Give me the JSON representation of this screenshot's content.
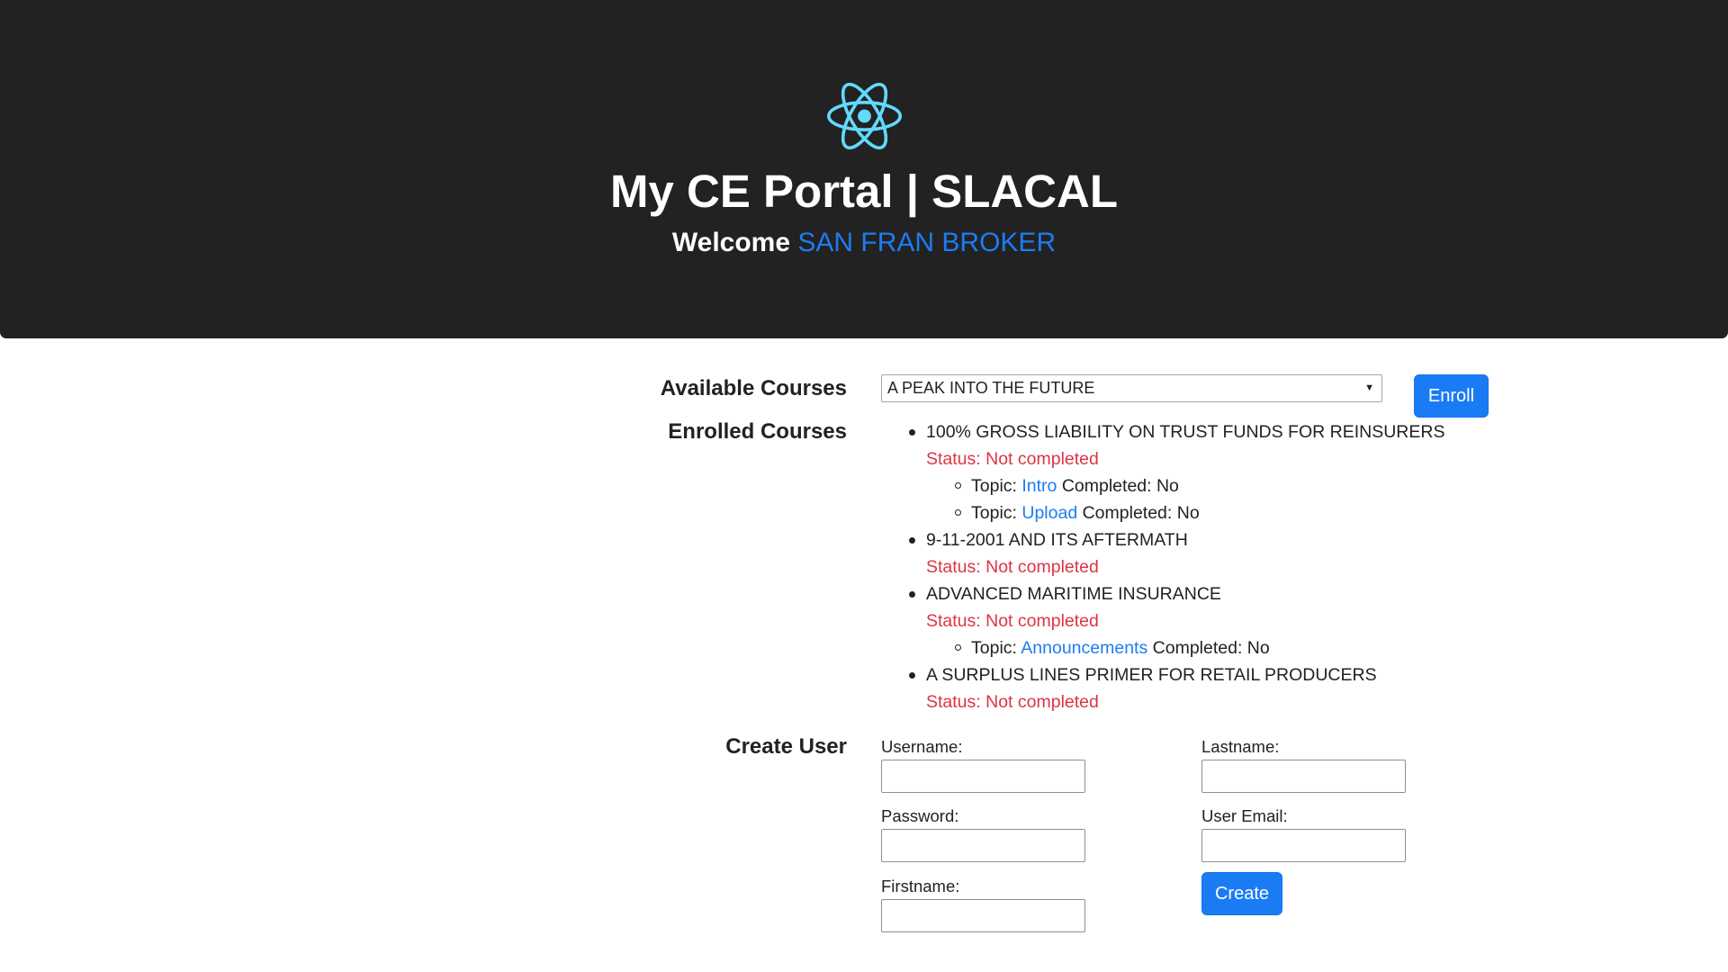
{
  "header": {
    "logo_icon": "react-atom-icon",
    "title": "My CE Portal | SLACAL",
    "welcome_prefix": "Welcome",
    "user_name": "SAN FRAN BROKER"
  },
  "available_courses": {
    "label": "Available Courses",
    "selected": "A PEAK INTO THE FUTURE",
    "enroll_label": "Enroll"
  },
  "enrolled_courses": {
    "label": "Enrolled Courses",
    "status_prefix": "Status:",
    "topic_prefix": "Topic:",
    "completed_prefix": "Completed:",
    "courses": [
      {
        "name": "100% GROSS LIABILITY ON TRUST FUNDS FOR REINSURERS",
        "status": "Not completed",
        "topics": [
          {
            "name": "Intro",
            "completed": "No"
          },
          {
            "name": "Upload",
            "completed": "No"
          }
        ]
      },
      {
        "name": "9-11-2001 AND ITS AFTERMATH",
        "status": "Not completed",
        "topics": []
      },
      {
        "name": "ADVANCED MARITIME INSURANCE",
        "status": "Not completed",
        "topics": [
          {
            "name": "Announcements",
            "completed": "No"
          }
        ]
      },
      {
        "name": "A SURPLUS LINES PRIMER FOR RETAIL PRODUCERS",
        "status": "Not completed",
        "topics": []
      }
    ]
  },
  "create_user": {
    "label": "Create User",
    "username_label": "Username:",
    "password_label": "Password:",
    "firstname_label": "Firstname:",
    "lastname_label": "Lastname:",
    "email_label": "User Email:",
    "create_label": "Create"
  },
  "colors": {
    "header_bg": "#222222",
    "accent": "#1a7cf5",
    "status_red": "#dc3545",
    "react_cyan": "#61dafb"
  }
}
